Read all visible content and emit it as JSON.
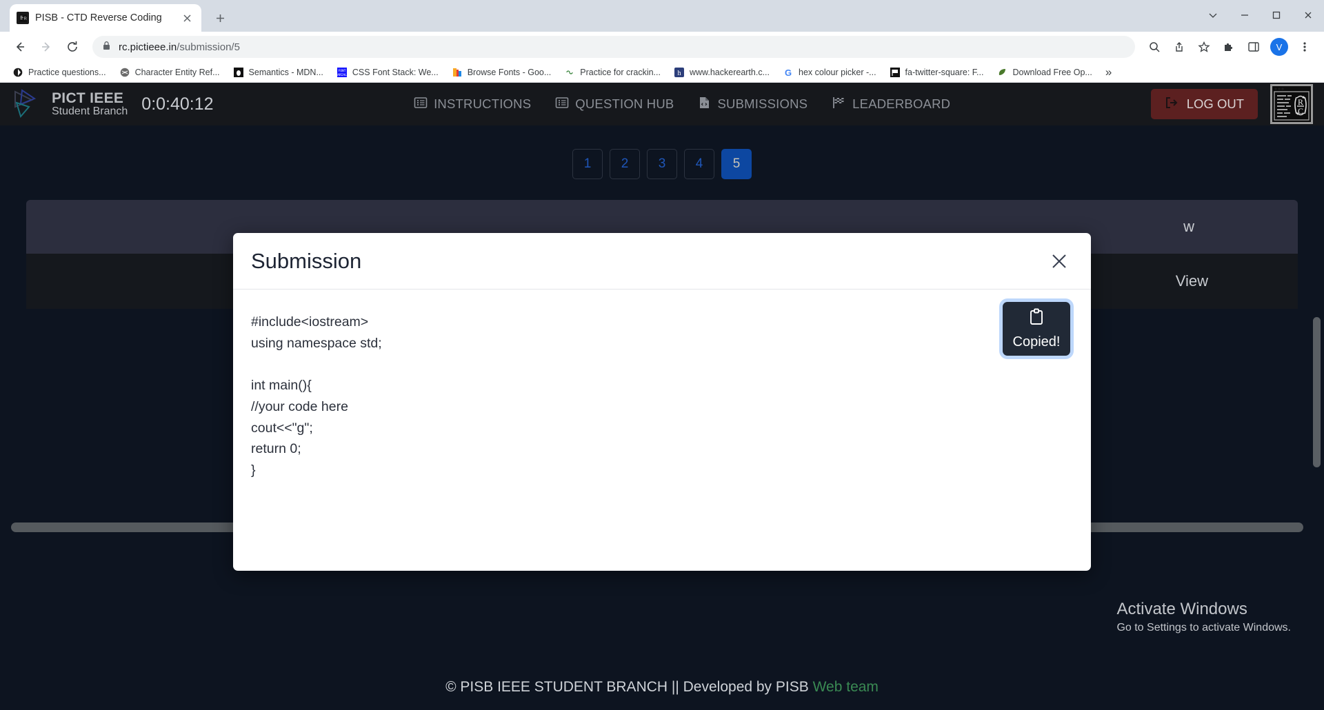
{
  "browser": {
    "tab": {
      "title": "PISB - CTD Reverse Coding",
      "favicon_icon": "rc-favicon",
      "close_icon": "close-icon"
    },
    "new_tab_icon": "plus-icon",
    "window_controls": {
      "minimize_icon": "chevron-down-icon",
      "minimize2_icon": "minimize-icon",
      "maximize_icon": "maximize-icon",
      "close_icon": "window-close-icon"
    },
    "nav": {
      "back_icon": "back-arrow-icon",
      "forward_icon": "forward-arrow-icon",
      "reload_icon": "reload-icon"
    },
    "omnibox": {
      "lock_icon": "lock-icon",
      "domain": "rc.pictieee.in",
      "path": "/submission/5",
      "zoom_icon": "zoom-search-icon",
      "share_icon": "share-icon",
      "bookmark_icon": "star-icon"
    },
    "toolbar": {
      "extensions_icon": "puzzle-icon",
      "sidepanel_icon": "side-panel-icon",
      "avatar_initial": "V",
      "menu_icon": "three-dot-menu-icon"
    },
    "bookmarks": [
      {
        "label": "Practice questions...",
        "icon": "dark-circle-icon",
        "glyph": "◖"
      },
      {
        "label": "Character Entity Ref...",
        "icon": "globe-icon",
        "glyph": "ἱ0"
      },
      {
        "label": "Semantics - MDN...",
        "icon": "mdn-icon",
        "glyph": "⬛"
      },
      {
        "label": "CSS Font Stack: We...",
        "icon": "cssfontstack-icon",
        "glyph": "▦"
      },
      {
        "label": "Browse Fonts - Goo...",
        "icon": "google-fonts-icon",
        "glyph": "▒"
      },
      {
        "label": "Practice for crackin...",
        "icon": "infinity-icon",
        "glyph": "∞"
      },
      {
        "label": "www.hackerearth.c...",
        "icon": "hackerearth-icon",
        "glyph": "h"
      },
      {
        "label": "hex colour picker -...",
        "icon": "google-icon",
        "glyph": "G"
      },
      {
        "label": "fa-twitter-square: F...",
        "icon": "flag-icon",
        "glyph": "⚑"
      },
      {
        "label": "Download Free Op...",
        "icon": "leaf-icon",
        "glyph": "❦"
      }
    ],
    "bookmarks_overflow": "»"
  },
  "site": {
    "brand": {
      "line1": "PICT IEEE",
      "line2": "Student Branch",
      "logo_icon": "pict-ieee-logo"
    },
    "timer": "0:0:40:12",
    "nav_items": [
      {
        "label": "INSTRUCTIONS",
        "icon": "list-icon"
      },
      {
        "label": "QUESTION HUB",
        "icon": "list-icon"
      },
      {
        "label": "SUBMISSIONS",
        "icon": "file-code-icon"
      },
      {
        "label": "LEADERBOARD",
        "icon": "checkered-flag-icon"
      }
    ],
    "logout": {
      "label": "LOG OUT",
      "icon": "logout-icon"
    },
    "rc_logo_icon": "reverse-coding-logo"
  },
  "pagination": {
    "pages": [
      "1",
      "2",
      "3",
      "4",
      "5"
    ],
    "active": "5",
    "active_color": "#0d47a1",
    "inactive_color": "#1f56b8"
  },
  "background": {
    "view_label_partial": "w",
    "view_label": "View"
  },
  "modal": {
    "title": "Submission",
    "close_icon": "close-icon",
    "code": "#include<iostream>\nusing namespace std;\n\nint main(){\n//your code here\ncout<<\"g\";\nreturn 0;\n}",
    "copy_button": {
      "label": "Copied!",
      "icon": "clipboard-icon",
      "focus_ring_color": "#bdd7fb",
      "background": "#212936"
    }
  },
  "footer": {
    "text_main": "© PISB IEEE STUDENT BRANCH || Developed by PISB ",
    "text_accent": "Web team",
    "accent_color": "#3a8a53"
  },
  "watermark": {
    "line1": "Activate Windows",
    "line2": "Go to Settings to activate Windows."
  }
}
